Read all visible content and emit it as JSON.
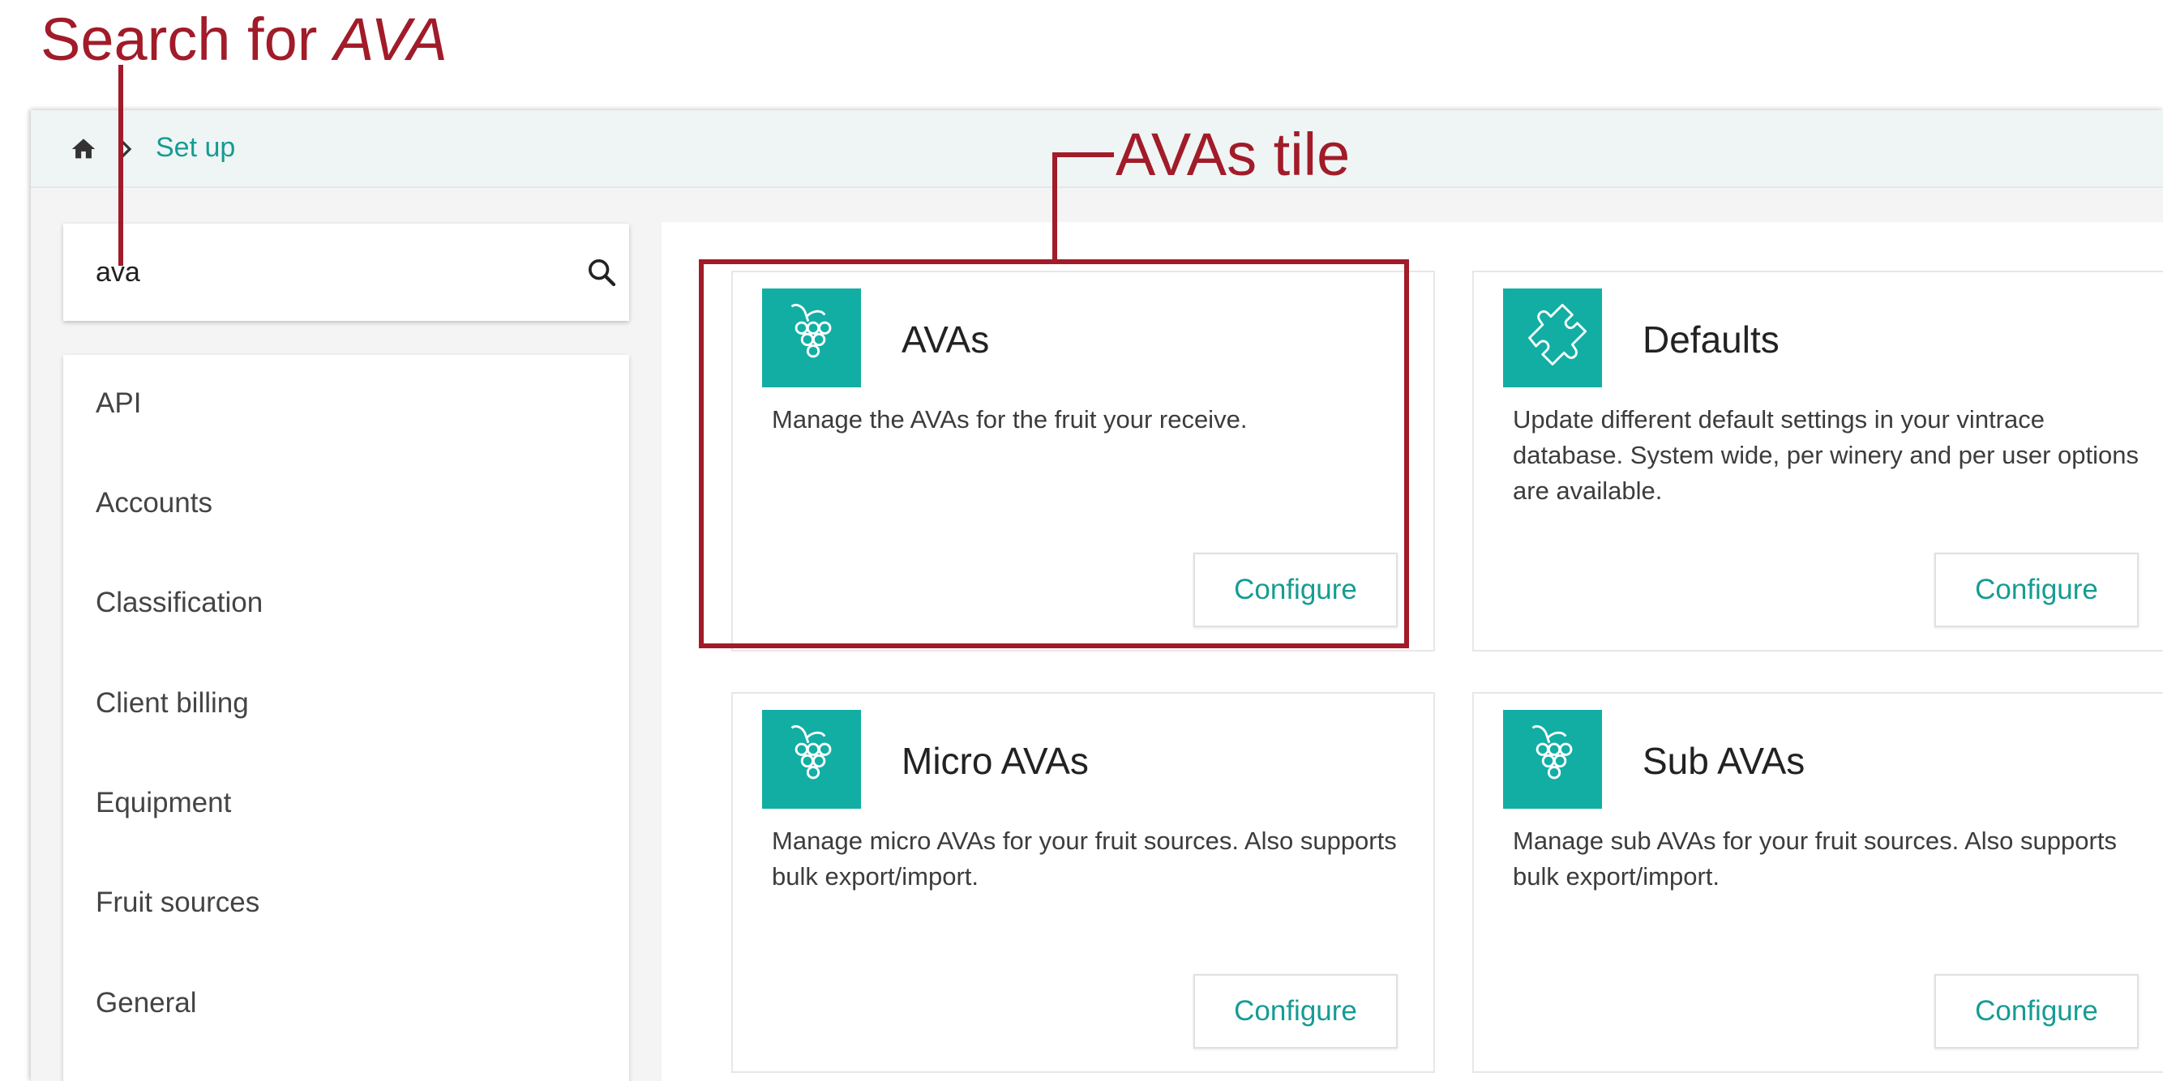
{
  "annotations": {
    "search_label_prefix": "Search for",
    "search_label_emph": "AVA",
    "tile_label": "AVAs tile"
  },
  "breadcrumb": {
    "home_icon": "home-icon",
    "separator_icon": "chevron-right-icon",
    "current": "Set up"
  },
  "search": {
    "value": "ava",
    "icon": "search-icon"
  },
  "nav": {
    "items": [
      "API",
      "Accounts",
      "Classification",
      "Client billing",
      "Equipment",
      "Fruit sources",
      "General"
    ]
  },
  "tiles": [
    {
      "title": "AVAs",
      "icon": "grapes-icon",
      "description": "Manage the AVAs for the fruit your receive.",
      "button": "Configure"
    },
    {
      "title": "Defaults",
      "icon": "puzzle-icon",
      "description": "Update different default settings in your vintrace database. System wide, per winery and per user options are available.",
      "button": "Configure"
    },
    {
      "title": "Micro AVAs",
      "icon": "grapes-icon",
      "description": "Manage micro AVAs for your fruit sources. Also supports bulk export/import.",
      "button": "Configure"
    },
    {
      "title": "Sub AVAs",
      "icon": "grapes-icon",
      "description": "Manage sub AVAs for your fruit sources. Also supports bulk export/import.",
      "button": "Configure"
    }
  ],
  "colors": {
    "annotation": "#a11b29",
    "accent": "#12aea4",
    "link": "#159c93"
  }
}
